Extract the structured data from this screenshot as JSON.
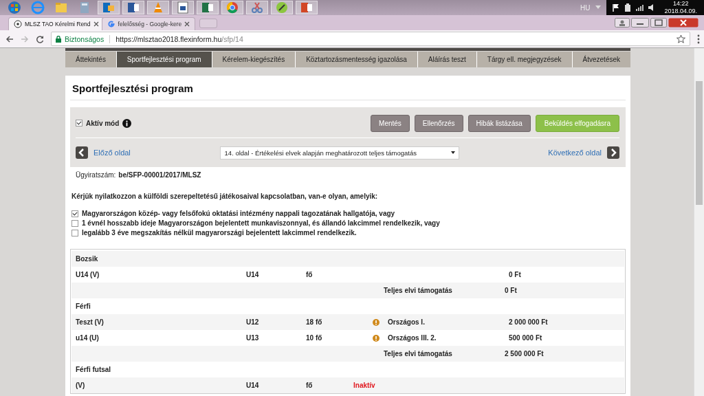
{
  "taskbar": {
    "language": "HU",
    "time": "14:22",
    "date": "2018.04.09."
  },
  "browser": {
    "tabs": [
      {
        "title": "MLSZ TAO Kérelmi Rend",
        "selected": true
      },
      {
        "title": "felelősség - Google-kere",
        "selected": false
      }
    ],
    "address": {
      "security": "Biztonságos",
      "url_main": "https://mlsztao2018.flexinform.hu",
      "url_path": "/sfp/14"
    }
  },
  "nav_tabs": [
    {
      "label": "Áttekintés",
      "selected": false
    },
    {
      "label": "Sportfejlesztési program",
      "selected": true
    },
    {
      "label": "Kérelem-kiegészítés",
      "selected": false
    },
    {
      "label": "Köztartozásmentesség igazolása",
      "selected": false
    },
    {
      "label": "Aláírás teszt",
      "selected": false
    },
    {
      "label": "Tárgy ell. megjegyzések",
      "selected": false
    },
    {
      "label": "Átvezetések",
      "selected": false
    }
  ],
  "title": "Sportfejlesztési program",
  "active_mode": {
    "label": "Aktív mód",
    "checked": true
  },
  "buttons": [
    {
      "label": "Mentés",
      "kind": "default"
    },
    {
      "label": "Ellenőrzés",
      "kind": "default"
    },
    {
      "label": "Hibák listázása",
      "kind": "default"
    },
    {
      "label": "Beküldés elfogadásra",
      "kind": "primary"
    }
  ],
  "prev_link": "Előző oldal",
  "next_link": "Következő oldal",
  "page_select": {
    "value": "14. oldal - Értékelési elvek alapján meghatározott teljes támogatás"
  },
  "case_number": {
    "label": "Ügyiratszám:",
    "value": "be/SFP-00001/2017/MLSZ"
  },
  "question": "Kérjük nyilatkozzon a külföldi szerepeltetésű játékosaival kapcsolatban, van-e olyan, amelyik:",
  "options": [
    {
      "label": "Magyarországon közép- vagy felsőfokú oktatási intézmény nappali tagozatának hallgatója, vagy",
      "checked": true
    },
    {
      "label": "1 évnél hosszabb ideje Magyarországon bejelentett munkaviszonnyal, és állandó lakcimmel rendelkezik, vagy",
      "checked": false
    },
    {
      "label": "legalább 3 éve megszakítás nélkül magyarországi bejelentett lakcimmel rendelkezik.",
      "checked": false
    }
  ],
  "table": {
    "rows": [
      {
        "kind": "group",
        "label": "Bozsik"
      },
      {
        "kind": "item",
        "name": "U14 (V)",
        "age": "U14",
        "count": "fő",
        "warning": false,
        "amount": "0 Ft"
      },
      {
        "kind": "total",
        "label": "Teljes elvi támogatás",
        "amount": "0 Ft"
      },
      {
        "kind": "group",
        "label": "Férfi"
      },
      {
        "kind": "item",
        "name": "Teszt (V)",
        "age": "U12",
        "count": "18 fő",
        "warning": true,
        "level": "Országos I.",
        "amount": "2 000 000 Ft"
      },
      {
        "kind": "item",
        "name": "u14 (U)",
        "age": "U13",
        "count": "10 fő",
        "warning": true,
        "level": "Országos III. 2.",
        "amount": "500 000 Ft"
      },
      {
        "kind": "total",
        "label": "Teljes elvi támogatás",
        "amount": "2 500 000 Ft"
      },
      {
        "kind": "group",
        "label": "Férfi futsal"
      },
      {
        "kind": "item",
        "name": "(V)",
        "age": "U14",
        "count": "fő",
        "warning": false,
        "status": "Inaktív"
      }
    ]
  }
}
